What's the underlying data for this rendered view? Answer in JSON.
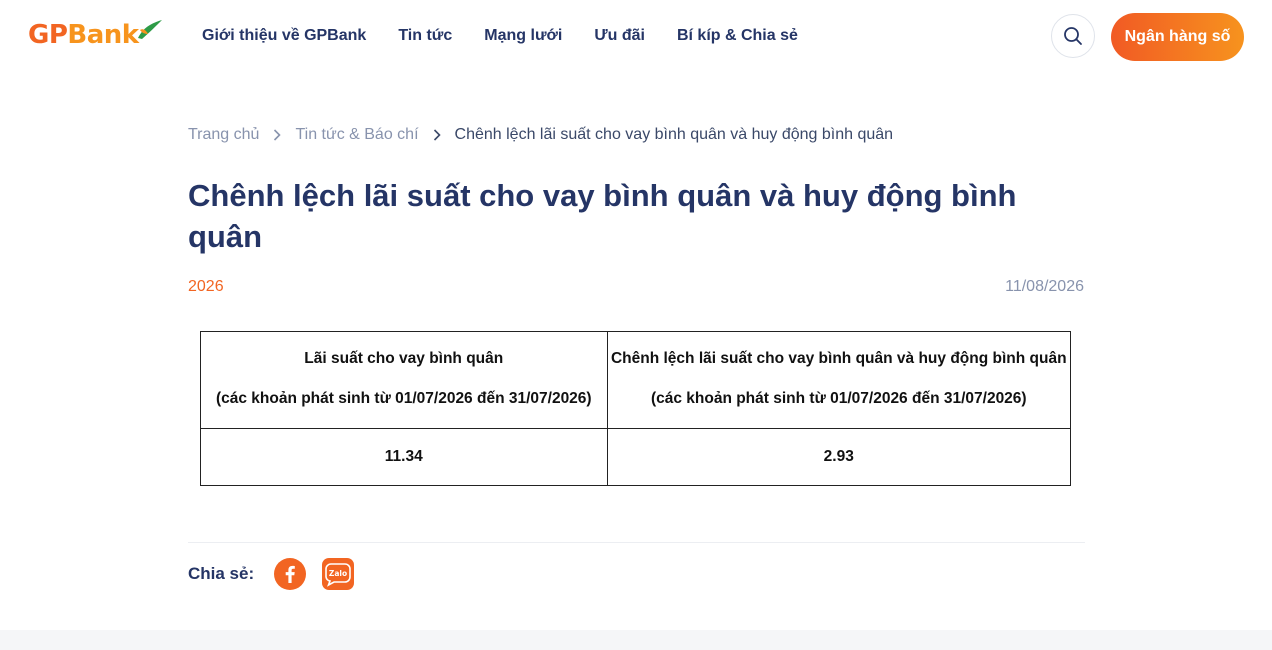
{
  "brand": {
    "logo_gp": "GP",
    "logo_bank": "Bank"
  },
  "nav": [
    {
      "label": "Giới thiệu về GPBank"
    },
    {
      "label": "Tin tức"
    },
    {
      "label": "Mạng lưới"
    },
    {
      "label": "Ưu đãi"
    },
    {
      "label": "Bí kíp & Chia sẻ"
    }
  ],
  "header": {
    "cta_label": "Ngân hàng số",
    "search_icon": "search-icon"
  },
  "breadcrumb": {
    "home": "Trang chủ",
    "section": "Tin tức & Báo chí",
    "current": "Chênh lệch lãi suất cho vay bình quân và huy động bình quân"
  },
  "article": {
    "title": "Chênh lệch lãi suất cho vay bình quân và huy động bình quân",
    "category": "2026",
    "date": "11/08/2026"
  },
  "table": {
    "headers": [
      {
        "line1": "Lãi suất cho vay bình quân",
        "line2": "(các khoản phát sinh từ 01/07/2026 đến 31/07/2026)"
      },
      {
        "line1": "Chênh lệch lãi suất cho vay bình quân và huy động bình quân",
        "line2": "(các khoản phát sinh từ 01/07/2026 đến 31/07/2026)"
      }
    ],
    "values": [
      "11.34",
      "2.93"
    ]
  },
  "share": {
    "label": "Chia sẻ:",
    "facebook_icon": "facebook-icon",
    "zalo_icon": "zalo-icon",
    "zalo_text": "Zalo"
  },
  "colors": {
    "brand_orange": "#f26522",
    "brand_orange_light": "#f7941d",
    "navy": "#253566",
    "leaf_green": "#2e9b47"
  }
}
